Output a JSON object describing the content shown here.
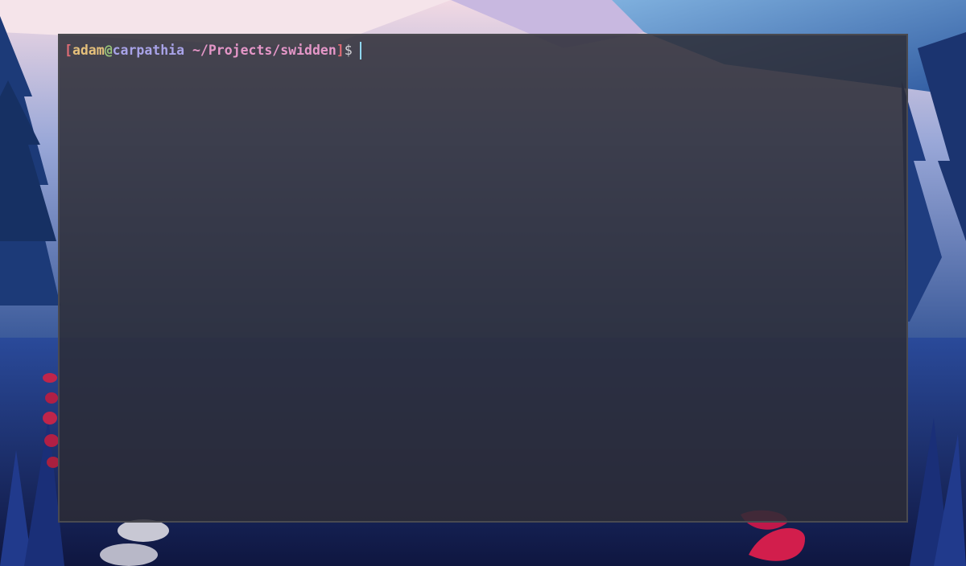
{
  "terminal": {
    "prompt": {
      "open_bracket": "[",
      "user": "adam",
      "at": "@",
      "host": "carpathia",
      "cwd": "~/Projects/swidden",
      "close_bracket": "]",
      "symbol": "$"
    },
    "colors": {
      "bracket": "#e06c75",
      "user": "#e5c07b",
      "at": "#98c379",
      "host": "#a8a3e8",
      "cwd": "#e597c8",
      "cursor": "#8fd6ef",
      "background": "#2c2c36"
    }
  },
  "wallpaper": {
    "description_icon": "forest-landscape"
  }
}
